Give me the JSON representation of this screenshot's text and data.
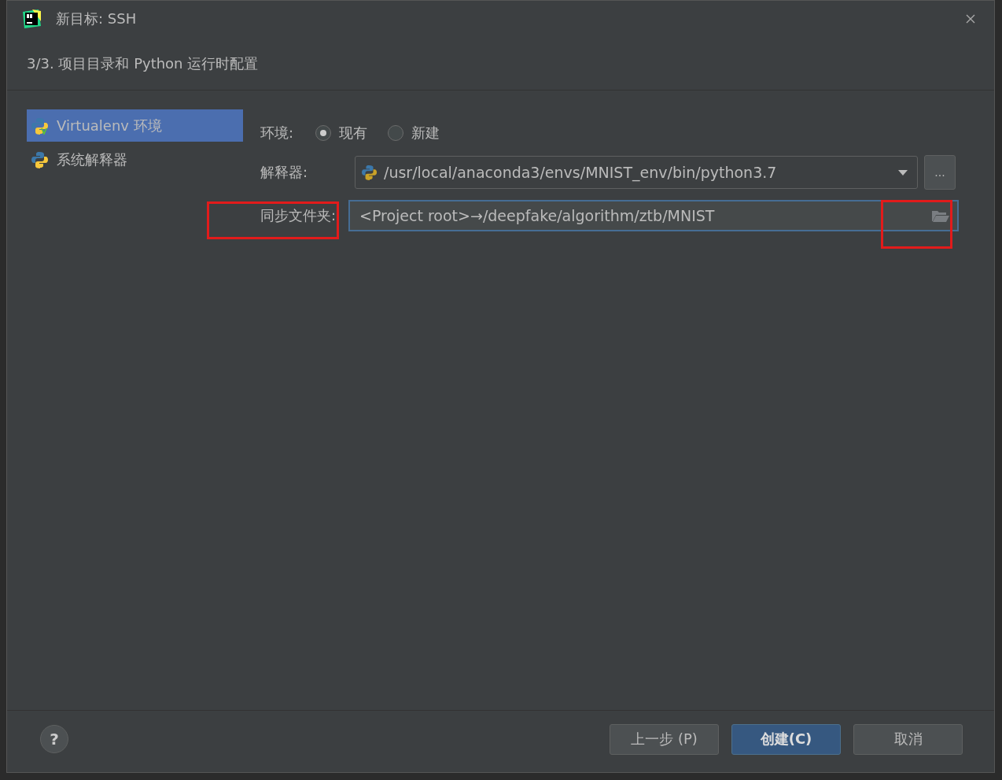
{
  "window": {
    "title": "新目标: SSH"
  },
  "step_title": "3/3. 项目目录和 Python 运行时配置",
  "sidebar": {
    "items": [
      {
        "label": "Virtualenv 环境",
        "kind": "virtualenv",
        "selected": true
      },
      {
        "label": "系统解释器",
        "kind": "system",
        "selected": false
      }
    ]
  },
  "form": {
    "environment": {
      "label": "环境:",
      "options": [
        {
          "label": "现有",
          "selected": true
        },
        {
          "label": "新建",
          "selected": false
        }
      ]
    },
    "interpreter": {
      "label": "解释器:",
      "value": "/usr/local/anaconda3/envs/MNIST_env/bin/python3.7",
      "browse": "..."
    },
    "sync_folder": {
      "label": "同步文件夹:",
      "value": "<Project root>→/deepfake/algorithm/ztb/MNIST",
      "focused": true
    }
  },
  "footer": {
    "help": "?",
    "buttons": [
      {
        "label": "上一步 (P)",
        "primary": false
      },
      {
        "label": "创建(C)",
        "primary": true
      },
      {
        "label": "取消",
        "primary": false
      }
    ]
  }
}
